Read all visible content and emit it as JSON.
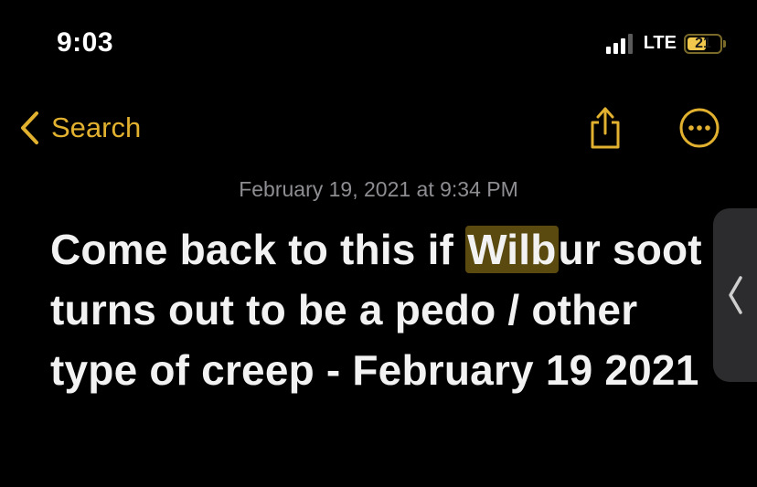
{
  "status_bar": {
    "time": "9:03",
    "network": "LTE",
    "battery_level": "21"
  },
  "nav": {
    "back_label": "Search",
    "share_icon": "share-icon",
    "more_icon": "ellipsis-circle-icon"
  },
  "note": {
    "date": "February 19, 2021 at 9:34 PM",
    "body_before": "Come back to this if ",
    "body_highlight": "Wilb",
    "body_after": "ur soot turns out to be a pedo / other type of creep - February 19 2021"
  },
  "colors": {
    "accent": "#e2b12f",
    "background": "#000000",
    "highlight": "#5a4a0f"
  }
}
